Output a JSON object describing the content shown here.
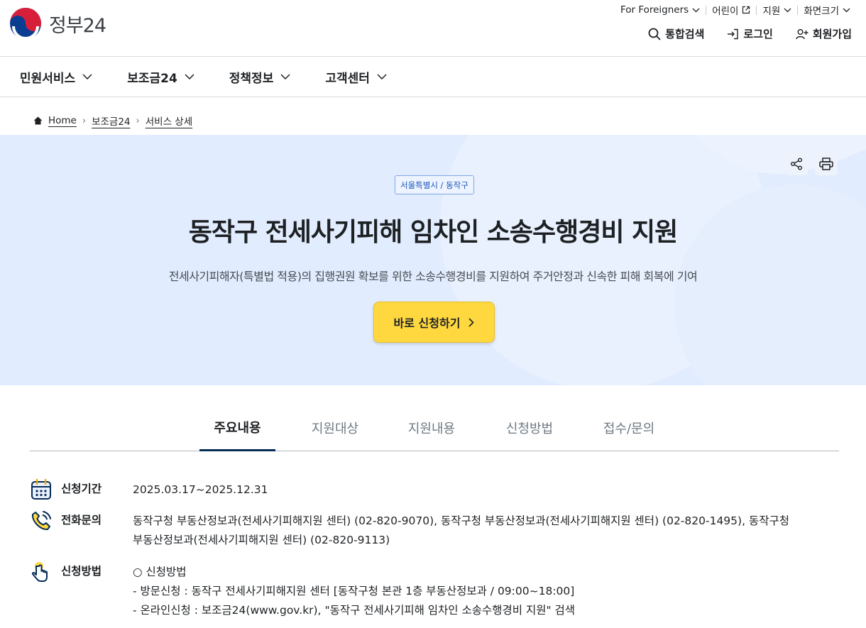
{
  "header": {
    "logo_text": "정부24",
    "util": [
      "For Foreigners",
      "어린이",
      "지원",
      "화면크기"
    ],
    "actions": {
      "search": "통합검색",
      "login": "로그인",
      "signup": "회원가입"
    }
  },
  "gnb": [
    "민원서비스",
    "보조금24",
    "정책정보",
    "고객센터"
  ],
  "breadcrumb": [
    "Home",
    "보조금24",
    "서비스 상세"
  ],
  "hero": {
    "region": "서울특별시 / 동작구",
    "title": "동작구 전세사기피해 임차인 소송수행경비 지원",
    "description": "전세사기피해자(특별법 적용)의 집행권원 확보를 위한 소송수행경비를 지원하여 주거안정과 신속한 피해 회복에 기여",
    "apply_label": "바로 신청하기"
  },
  "tabs": [
    "주요내용",
    "지원대상",
    "지원내용",
    "신청방법",
    "접수/문의"
  ],
  "info": {
    "period": {
      "label": "신청기간",
      "value": "2025.03.17~2025.12.31"
    },
    "phone": {
      "label": "전화문의",
      "lines": [
        "동작구청 부동산정보과(전세사기피해지원 센터) (02-820-9070), 동작구청 부동산정보과(전세사기피해지원 센터) (02-820-1495), 동작구청",
        "부동산정보과(전세사기피해지원 센터) (02-820-9113)"
      ]
    },
    "method": {
      "label": "신청방법",
      "lines": [
        "○ 신청방법",
        "- 방문신청 : 동작구 전세사기피해지원 센터 [동작구청 본관 1층 부동산정보과 / 09:00~18:00]",
        "- 온라인신청 : 보조금24(www.gov.kr), \"동작구 전세사기피해 임차인 소송수행경비 지원\" 검색"
      ]
    }
  },
  "colors": {
    "accent_yellow": "#ffd83f",
    "hero_bg": "#e1ecfe",
    "tab_active": "#052b57",
    "icon_blue": "#1d56bc"
  }
}
